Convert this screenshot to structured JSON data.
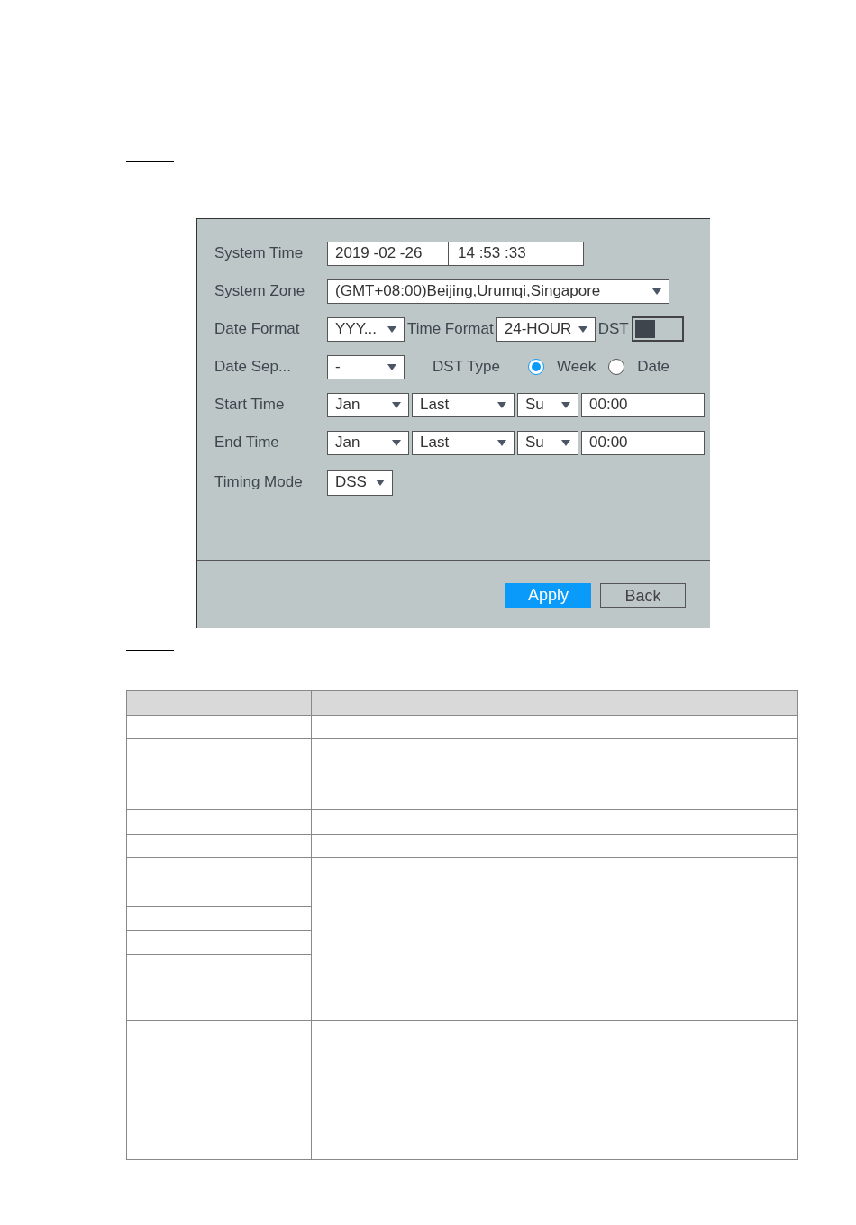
{
  "settings": {
    "system_time": {
      "label": "System Time",
      "date": "2019 -02 -26",
      "time": "14 :53 :33"
    },
    "system_zone": {
      "label": "System Zone",
      "value": "(GMT+08:00)Beijing,Urumqi,Singapore"
    },
    "date_format": {
      "label": "Date Format",
      "value": "YYY..."
    },
    "time_format": {
      "label": "Time Format",
      "value": "24-HOUR"
    },
    "dst": {
      "label": "DST",
      "on": false
    },
    "date_separator": {
      "label": "Date Sep...",
      "value": "-"
    },
    "dst_type": {
      "label": "DST Type",
      "options": [
        {
          "label": "Week",
          "selected": true
        },
        {
          "label": "Date",
          "selected": false
        }
      ]
    },
    "start_time": {
      "label": "Start Time",
      "month": "Jan",
      "week": "Last",
      "day": "Su",
      "time": "00:00"
    },
    "end_time": {
      "label": "End Time",
      "month": "Jan",
      "week": "Last",
      "day": "Su",
      "time": "00:00"
    },
    "timing_mode": {
      "label": "Timing Mode",
      "value": "DSS"
    }
  },
  "buttons": [
    {
      "label": "Apply",
      "kind": "primary"
    },
    {
      "label": "Back",
      "kind": "secondary"
    }
  ]
}
